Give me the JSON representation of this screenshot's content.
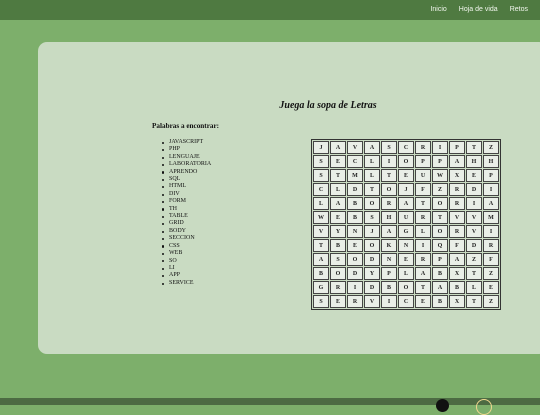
{
  "nav": {
    "links": [
      {
        "label": "Inicio"
      },
      {
        "label": "Hoja de vida"
      },
      {
        "label": "Retos"
      }
    ]
  },
  "main": {
    "title": "Juega la sopa de Letras",
    "words_heading": "Palabras a encontrar:",
    "words": [
      "JAVASCRIPT",
      "PHP",
      "LENGUAJE",
      "LABORATORIA",
      "APRENDO",
      "SQL",
      "HTML",
      "DIV",
      "FORM",
      "TH",
      "TABLE",
      "GRID",
      "BODY",
      "SECCION",
      "CSS",
      "WEB",
      "SO",
      "LI",
      "APP",
      "SERVICE"
    ],
    "grid": [
      [
        "J",
        "A",
        "V",
        "A",
        "S",
        "C",
        "R",
        "I",
        "P",
        "T",
        "Z"
      ],
      [
        "S",
        "E",
        "C",
        "L",
        "I",
        "O",
        "P",
        "P",
        "A",
        "H",
        "H"
      ],
      [
        "S",
        "T",
        "M",
        "L",
        "T",
        "E",
        "U",
        "W",
        "X",
        "E",
        "P"
      ],
      [
        "C",
        "L",
        "D",
        "T",
        "O",
        "J",
        "F",
        "Z",
        "R",
        "D",
        "I"
      ],
      [
        "L",
        "A",
        "B",
        "O",
        "R",
        "A",
        "T",
        "O",
        "R",
        "I",
        "A"
      ],
      [
        "W",
        "E",
        "B",
        "S",
        "H",
        "U",
        "R",
        "T",
        "V",
        "V",
        "M"
      ],
      [
        "V",
        "Y",
        "N",
        "J",
        "A",
        "G",
        "L",
        "O",
        "R",
        "V",
        "I"
      ],
      [
        "T",
        "B",
        "E",
        "O",
        "K",
        "N",
        "I",
        "Q",
        "F",
        "D",
        "R"
      ],
      [
        "A",
        "S",
        "O",
        "D",
        "N",
        "E",
        "R",
        "P",
        "A",
        "Z",
        "F"
      ],
      [
        "B",
        "O",
        "D",
        "Y",
        "P",
        "L",
        "A",
        "B",
        "X",
        "T",
        "Z"
      ],
      [
        "G",
        "R",
        "I",
        "D",
        "B",
        "O",
        "T",
        "A",
        "B",
        "L",
        "E"
      ],
      [
        "S",
        "E",
        "R",
        "V",
        "I",
        "C",
        "E",
        "B",
        "X",
        "T",
        "Z"
      ]
    ]
  }
}
